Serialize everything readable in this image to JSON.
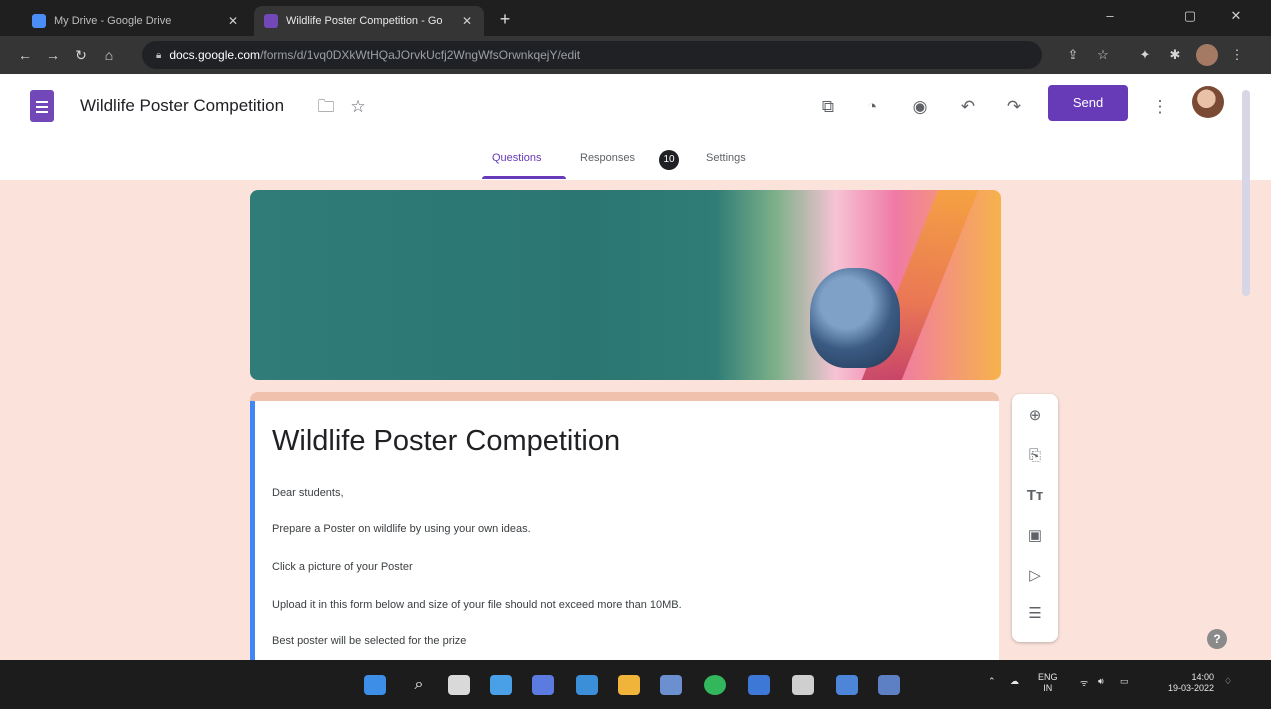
{
  "browser": {
    "tabs": [
      {
        "title": "My Drive - Google Drive",
        "active": false,
        "favicon_color": "#4a8df6"
      },
      {
        "title": "Wildlife Poster Competition - Go",
        "active": true,
        "favicon_color": "#7248b9"
      }
    ],
    "new_tab_symbol": "+",
    "omnibox": {
      "host": "docs.google.com",
      "path": "/forms/d/1vq0DXkWtHQaJOrvkUcfj2WngWfsOrwnkqejY/edit"
    }
  },
  "form_header": {
    "doc_title": "Wildlife Poster Competition",
    "send_label": "Send",
    "tabs": [
      {
        "label": "Questions",
        "active": true
      },
      {
        "label": "Responses",
        "active": false,
        "badge": "10"
      },
      {
        "label": "Settings",
        "active": false
      }
    ]
  },
  "form": {
    "title": "Wildlife Poster Competition",
    "description": [
      "Dear students,",
      "Prepare a Poster on wildlife by using your own ideas.",
      "Click a picture of your Poster",
      "Upload it in this form below and size of your file should not exceed more than 10MB.",
      "Best poster will be selected for the prize"
    ]
  },
  "sidebar_tools": [
    "add-question-icon",
    "import-questions-icon",
    "add-title-icon",
    "add-image-icon",
    "add-video-icon",
    "add-section-icon"
  ],
  "tray": {
    "language": "ENG",
    "region": "IN",
    "time": "14:00",
    "date": "19-03-2022"
  },
  "colors": {
    "accent": "#673ab7",
    "page_background": "#fbe3dc",
    "card_top": "#f0c1ad"
  }
}
